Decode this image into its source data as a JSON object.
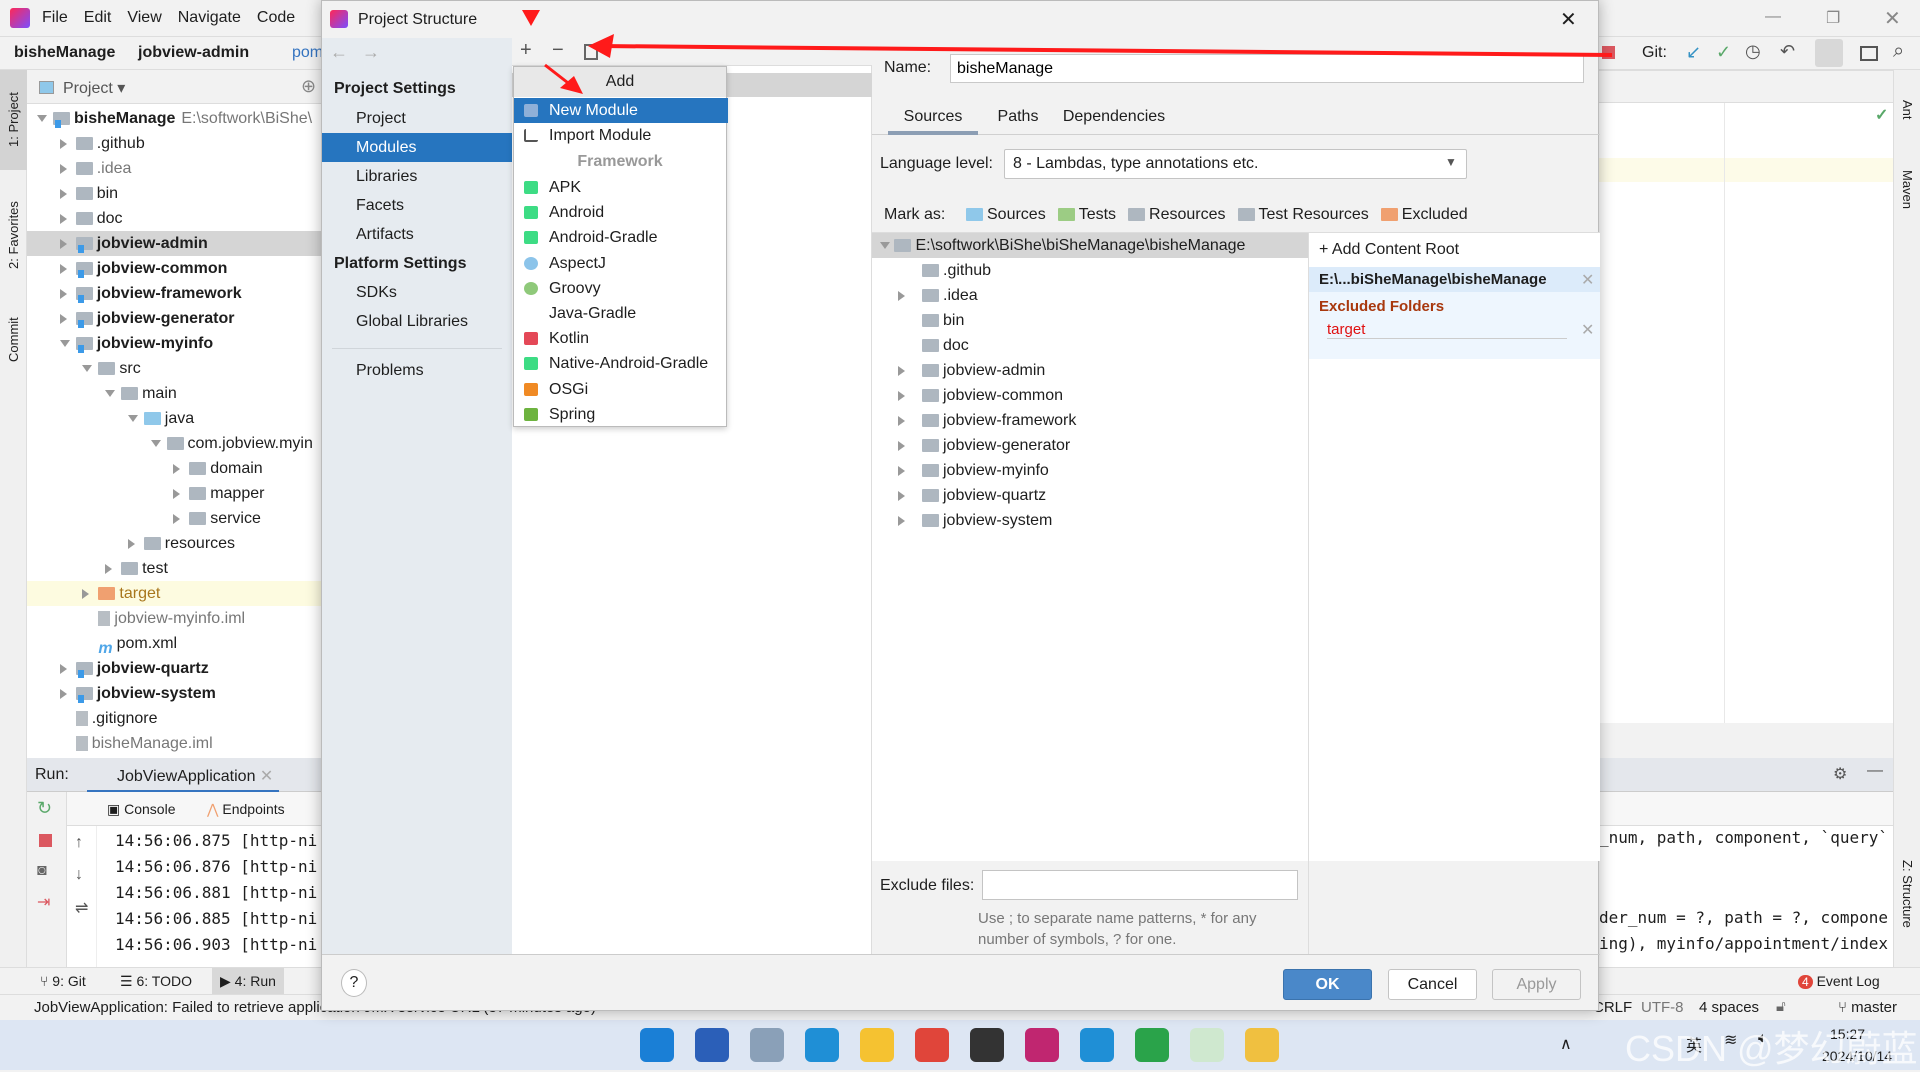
{
  "ide": {
    "menu": [
      "File",
      "Edit",
      "View",
      "Navigate",
      "Code"
    ],
    "breadcrumb": [
      "bisheManage",
      "jobview-admin",
      "pom"
    ],
    "project_header": "Project",
    "root_path": "E:\\softwork\\BiShe\\",
    "tree": [
      {
        "name": "bisheManage",
        "depth": 0,
        "state": "expanded",
        "icon": "module",
        "bold": true
      },
      {
        "name": ".github",
        "depth": 1,
        "state": "collapsed",
        "icon": "folder"
      },
      {
        "name": ".idea",
        "depth": 1,
        "state": "collapsed",
        "icon": "folder",
        "dim": true
      },
      {
        "name": "bin",
        "depth": 1,
        "state": "collapsed",
        "icon": "folder"
      },
      {
        "name": "doc",
        "depth": 1,
        "state": "collapsed",
        "icon": "folder"
      },
      {
        "name": "jobview-admin",
        "depth": 1,
        "state": "collapsed",
        "icon": "module",
        "bold": true,
        "selected": true
      },
      {
        "name": "jobview-common",
        "depth": 1,
        "state": "collapsed",
        "icon": "module",
        "bold": true
      },
      {
        "name": "jobview-framework",
        "depth": 1,
        "state": "collapsed",
        "icon": "module",
        "bold": true
      },
      {
        "name": "jobview-generator",
        "depth": 1,
        "state": "collapsed",
        "icon": "module",
        "bold": true
      },
      {
        "name": "jobview-myinfo",
        "depth": 1,
        "state": "expanded",
        "icon": "module",
        "bold": true
      },
      {
        "name": "src",
        "depth": 2,
        "state": "expanded",
        "icon": "folder"
      },
      {
        "name": "main",
        "depth": 3,
        "state": "expanded",
        "icon": "folder"
      },
      {
        "name": "java",
        "depth": 4,
        "state": "expanded",
        "icon": "source"
      },
      {
        "name": "com.jobview.myin",
        "depth": 5,
        "state": "expanded",
        "icon": "package"
      },
      {
        "name": "domain",
        "depth": 6,
        "state": "collapsed",
        "icon": "package"
      },
      {
        "name": "mapper",
        "depth": 6,
        "state": "collapsed",
        "icon": "package"
      },
      {
        "name": "service",
        "depth": 6,
        "state": "collapsed",
        "icon": "package"
      },
      {
        "name": "resources",
        "depth": 4,
        "state": "collapsed",
        "icon": "resources"
      },
      {
        "name": "test",
        "depth": 3,
        "state": "collapsed",
        "icon": "folder"
      },
      {
        "name": "target",
        "depth": 2,
        "state": "collapsed",
        "icon": "excluded",
        "highlight": true
      },
      {
        "name": "jobview-myinfo.iml",
        "depth": 2,
        "state": "none",
        "icon": "file",
        "dim": true
      },
      {
        "name": "pom.xml",
        "depth": 2,
        "state": "none",
        "icon": "maven"
      },
      {
        "name": "jobview-quartz",
        "depth": 1,
        "state": "collapsed",
        "icon": "module",
        "bold": true
      },
      {
        "name": "jobview-system",
        "depth": 1,
        "state": "collapsed",
        "icon": "module",
        "bold": true
      },
      {
        "name": ".gitignore",
        "depth": 1,
        "state": "none",
        "icon": "file"
      },
      {
        "name": "bisheManage.iml",
        "depth": 1,
        "state": "none",
        "icon": "file",
        "dim": true
      }
    ],
    "side_tabs": [
      "1: Project",
      "2: Favorites",
      "Commit"
    ],
    "right_tabs": [
      "Ant",
      "Maven",
      "Z: Structure"
    ],
    "git_label": "Git:",
    "run": {
      "label": "Run:",
      "tab": "JobViewApplication",
      "console": "Console",
      "endpoints": "Endpoints",
      "lines": [
        "14:56:06.875 [http-ni",
        "14:56:06.876 [http-ni",
        "14:56:06.881 [http-ni",
        "14:56:06.885 [http-ni",
        "14:56:06.903 [http-ni"
      ],
      "right_lines": [
        "_num, path, component, `query`",
        "der_num = ?, path = ?, compone",
        "ing), myinfo/appointment/index"
      ]
    },
    "bottom_tabs": [
      "9: Git",
      "6: TODO",
      "4: Run"
    ],
    "event_log": "Event Log",
    "event_count": "4",
    "status": {
      "message": "JobViewApplication: Failed to retrieve application JMX service URL (37 minutes ago)",
      "crlf": "CRLF",
      "encoding": "UTF-8",
      "indent": "4 spaces",
      "branch": "master"
    }
  },
  "dialog": {
    "title": "Project Structure",
    "nav": {
      "project_settings": "Project Settings",
      "items1": [
        "Project",
        "Modules",
        "Libraries",
        "Facets",
        "Artifacts"
      ],
      "platform_settings": "Platform Settings",
      "items2": [
        "SDKs",
        "Global Libraries"
      ],
      "problems": "Problems",
      "selected": "Modules"
    },
    "popup": {
      "header": "Add",
      "items": [
        {
          "label": "New Module",
          "icon": "new-module-icon",
          "selected": true
        },
        {
          "label": "Import Module",
          "icon": "import-module-icon"
        }
      ],
      "section": "Framework",
      "frameworks": [
        {
          "label": "APK",
          "icon": "android-icon",
          "color": "#3ddc84"
        },
        {
          "label": "Android",
          "icon": "android-icon",
          "color": "#3ddc84"
        },
        {
          "label": "Android-Gradle",
          "icon": "android-icon",
          "color": "#3ddc84"
        },
        {
          "label": "AspectJ",
          "icon": "aspectj-icon",
          "color": "#8cc4ea"
        },
        {
          "label": "Groovy",
          "icon": "groovy-icon",
          "color": "#8fc97a"
        },
        {
          "label": "Java-Gradle",
          "icon": "",
          "color": ""
        },
        {
          "label": "Kotlin",
          "icon": "kotlin-icon",
          "color": "#e44857"
        },
        {
          "label": "Native-Android-Gradle",
          "icon": "android-icon",
          "color": "#3ddc84"
        },
        {
          "label": "OSGi",
          "icon": "osgi-icon",
          "color": "#f08a24"
        },
        {
          "label": "Spring",
          "icon": "spring-icon",
          "color": "#6db33f"
        }
      ]
    },
    "name_label": "Name:",
    "name_value": "bisheManage",
    "tabs": [
      "Sources",
      "Paths",
      "Dependencies"
    ],
    "active_tab": "Sources",
    "language_label": "Language level:",
    "language_value": "8 - Lambdas, type annotations etc.",
    "mark_as": "Mark as:",
    "marks": [
      {
        "label": "Sources",
        "color": "#8fc8ea"
      },
      {
        "label": "Tests",
        "color": "#9ccc84"
      },
      {
        "label": "Resources",
        "color": "#aeb7c0"
      },
      {
        "label": "Test Resources",
        "color": "#aeb7c0"
      },
      {
        "label": "Excluded",
        "color": "#f0a070"
      }
    ],
    "root": "E:\\softwork\\BiShe\\biSheManage\\bisheManage",
    "folders": [
      {
        "name": ".github",
        "arrow": false
      },
      {
        "name": ".idea",
        "arrow": true
      },
      {
        "name": "bin",
        "arrow": false
      },
      {
        "name": "doc",
        "arrow": false
      },
      {
        "name": "jobview-admin",
        "arrow": true
      },
      {
        "name": "jobview-common",
        "arrow": true
      },
      {
        "name": "jobview-framework",
        "arrow": true
      },
      {
        "name": "jobview-generator",
        "arrow": true
      },
      {
        "name": "jobview-myinfo",
        "arrow": true
      },
      {
        "name": "jobview-quartz",
        "arrow": true
      },
      {
        "name": "jobview-system",
        "arrow": true
      }
    ],
    "add_content_root": "Add Content Root",
    "content_root": "E:\\...biSheManage\\bisheManage",
    "excluded_title": "Excluded Folders",
    "excluded_item": "target",
    "exclude_label": "Exclude files:",
    "exclude_value": "",
    "hint": [
      "Use ; to separate name patterns, * for any",
      "number of symbols, ? for one."
    ],
    "ok": "OK",
    "cancel": "Cancel",
    "apply": "Apply",
    "help": "?"
  },
  "taskbar": {
    "time": "15:27",
    "date": "2024/10/14",
    "ime": "英",
    "watermark": "CSDN @梦幻蔚蓝"
  },
  "colors": {
    "accent": "#2675bf",
    "selection": "#2675bf",
    "annotation": "#ff1a1a",
    "excluded": "#cc0000"
  }
}
